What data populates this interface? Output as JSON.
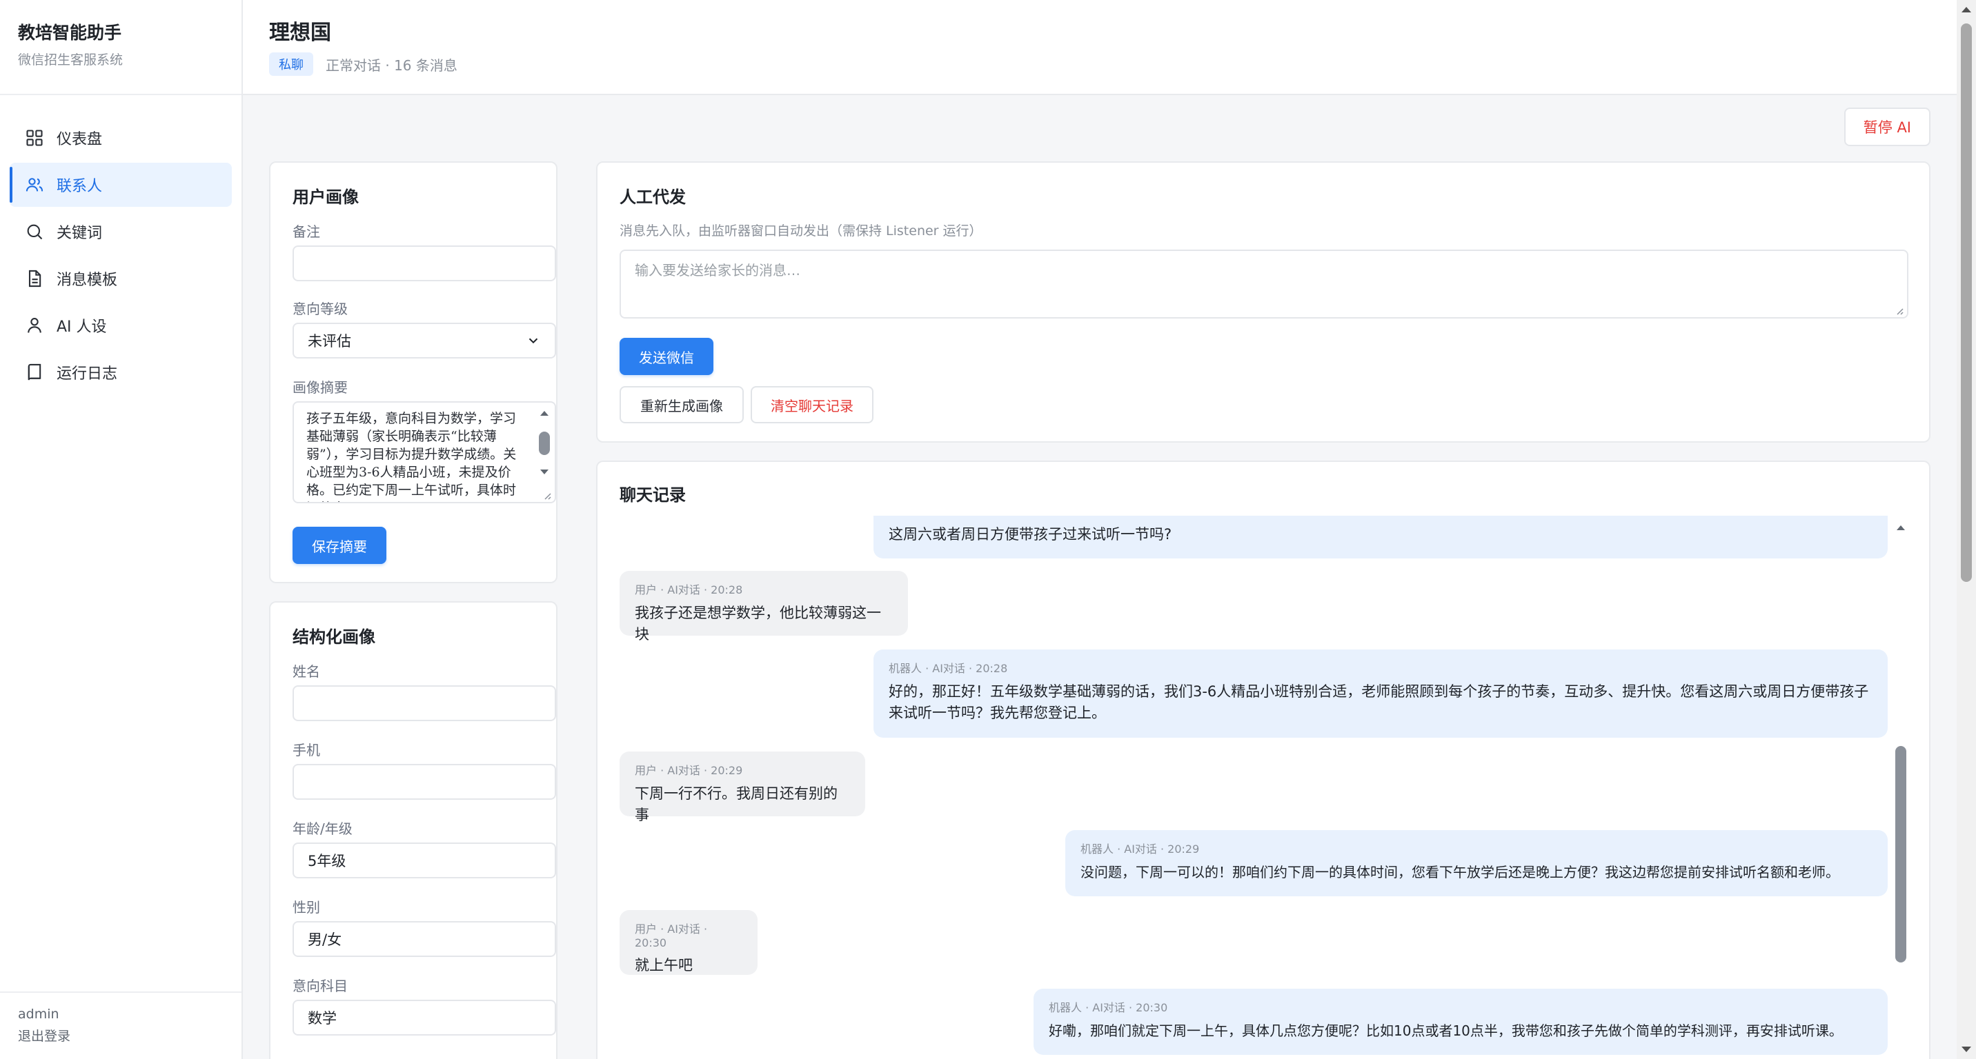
{
  "sidebar": {
    "title": "教培智能助手",
    "subtitle": "微信招生客服系统",
    "items": [
      {
        "label": "仪表盘",
        "icon": "grid-icon"
      },
      {
        "label": "联系人",
        "icon": "users-icon"
      },
      {
        "label": "关键词",
        "icon": "search-icon"
      },
      {
        "label": "消息模板",
        "icon": "document-icon"
      },
      {
        "label": "AI 人设",
        "icon": "person-icon"
      },
      {
        "label": "运行日志",
        "icon": "book-icon"
      }
    ],
    "active_index": 1,
    "user": "admin",
    "logout": "退出登录"
  },
  "header": {
    "title": "理想国",
    "badge": "私聊",
    "meta": "正常对话 · 16 条消息"
  },
  "toolbar": {
    "pause_label": "暂停 AI"
  },
  "profile": {
    "title": "用户画像",
    "remark_label": "备注",
    "remark_value": "",
    "intent_label": "意向等级",
    "intent_value": "未评估",
    "summary_label": "画像摘要",
    "summary_value": "孩子五年级，意向科目为数学，学习基础薄弱（家长明确表示“比较薄弱”），学习目标为提升数学成绩。关心班型为3-6人精品小班，未提及价格。已约定下周一上午试听，具体时间待定。",
    "save_label": "保存摘要"
  },
  "structured": {
    "title": "结构化画像",
    "name_label": "姓名",
    "name_value": "",
    "phone_label": "手机",
    "phone_value": "",
    "grade_label": "年龄/年级",
    "grade_value": "5年级",
    "gender_label": "性别",
    "gender_value": "男/女",
    "subject_label": "意向科目",
    "subject_value": "数学"
  },
  "manual": {
    "title": "人工代发",
    "hint": "消息先入队，由监听器窗口自动发出（需保持 Listener 运行）",
    "placeholder": "输入要发送给家长的消息…",
    "send_label": "发送微信",
    "regen_label": "重新生成画像",
    "clear_label": "清空聊天记录"
  },
  "chat": {
    "title": "聊天记录",
    "partial_top": "这周六或者周日方便带孩子过来试听一节吗?",
    "messages": [
      {
        "role": "user",
        "meta": "用户 · AI对话 · 20:28",
        "text": "我孩子还是想学数学，他比较薄弱这一块"
      },
      {
        "role": "bot",
        "meta": "机器人 · AI对话 · 20:28",
        "text": "好的，那正好！五年级数学基础薄弱的话，我们3-6人精品小班特别合适，老师能照顾到每个孩子的节奏，互动多、提升快。您看这周六或周日方便带孩子来试听一节吗？我先帮您登记上。"
      },
      {
        "role": "user",
        "meta": "用户 · AI对话 · 20:29",
        "text": "下周一行不行。我周日还有别的事"
      },
      {
        "role": "bot",
        "meta": "机器人 · AI对话 · 20:29",
        "text": "没问题，下周一可以的！那咱们约下周一的具体时间，您看下午放学后还是晚上方便？我这边帮您提前安排试听名额和老师。"
      },
      {
        "role": "user",
        "meta": "用户 · AI对话 · 20:30",
        "text": "就上午吧"
      },
      {
        "role": "bot",
        "meta": "机器人 · AI对话 · 20:30",
        "text": "好嘞，那咱们就定下周一上午，具体几点您方便呢？比如10点或者10点半，我带您和孩子先做个简单的学科测评，再安排试听课。"
      }
    ]
  },
  "colors": {
    "accent": "#2b7ff0",
    "danger": "#e53935",
    "active_nav_bg": "#eaf3ff",
    "bot_bubble": "#e8f1fd",
    "user_bubble": "#f0f1f3"
  }
}
